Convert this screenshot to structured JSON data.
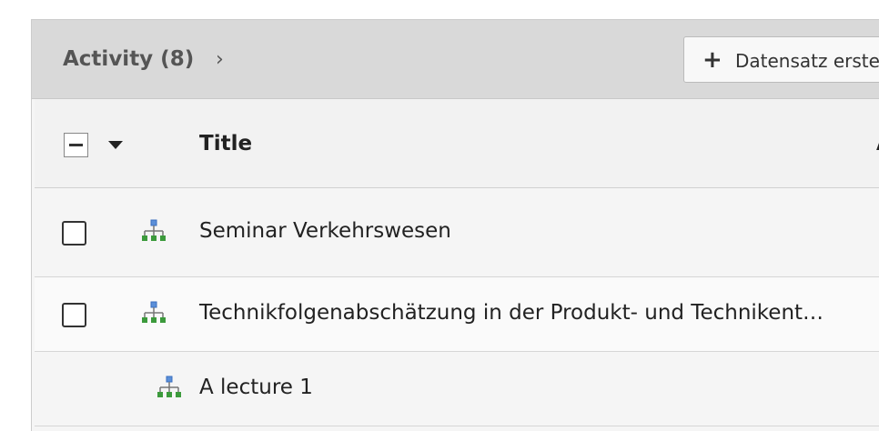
{
  "panel": {
    "title": "Activity (8)",
    "chevron": "›",
    "new_record_label": "Datensatz erste",
    "new_record_icon": "plus-icon"
  },
  "table": {
    "columns": [
      {
        "label": "Title"
      },
      {
        "label": "A"
      }
    ],
    "rows": [
      {
        "title": "Seminar Verkehrswesen",
        "icon": "hierarchy-icon",
        "has_checkbox": true
      },
      {
        "title": "Technikfolgenabschätzung in der Produkt- und Technikent…",
        "icon": "hierarchy-icon",
        "has_checkbox": true
      },
      {
        "title": "A lecture 1",
        "icon": "hierarchy-icon",
        "has_checkbox": false
      }
    ]
  },
  "colors": {
    "header_bg": "#d9d9d9",
    "icon_blue": "#5b8fd8",
    "icon_green": "#3c9a3c"
  }
}
